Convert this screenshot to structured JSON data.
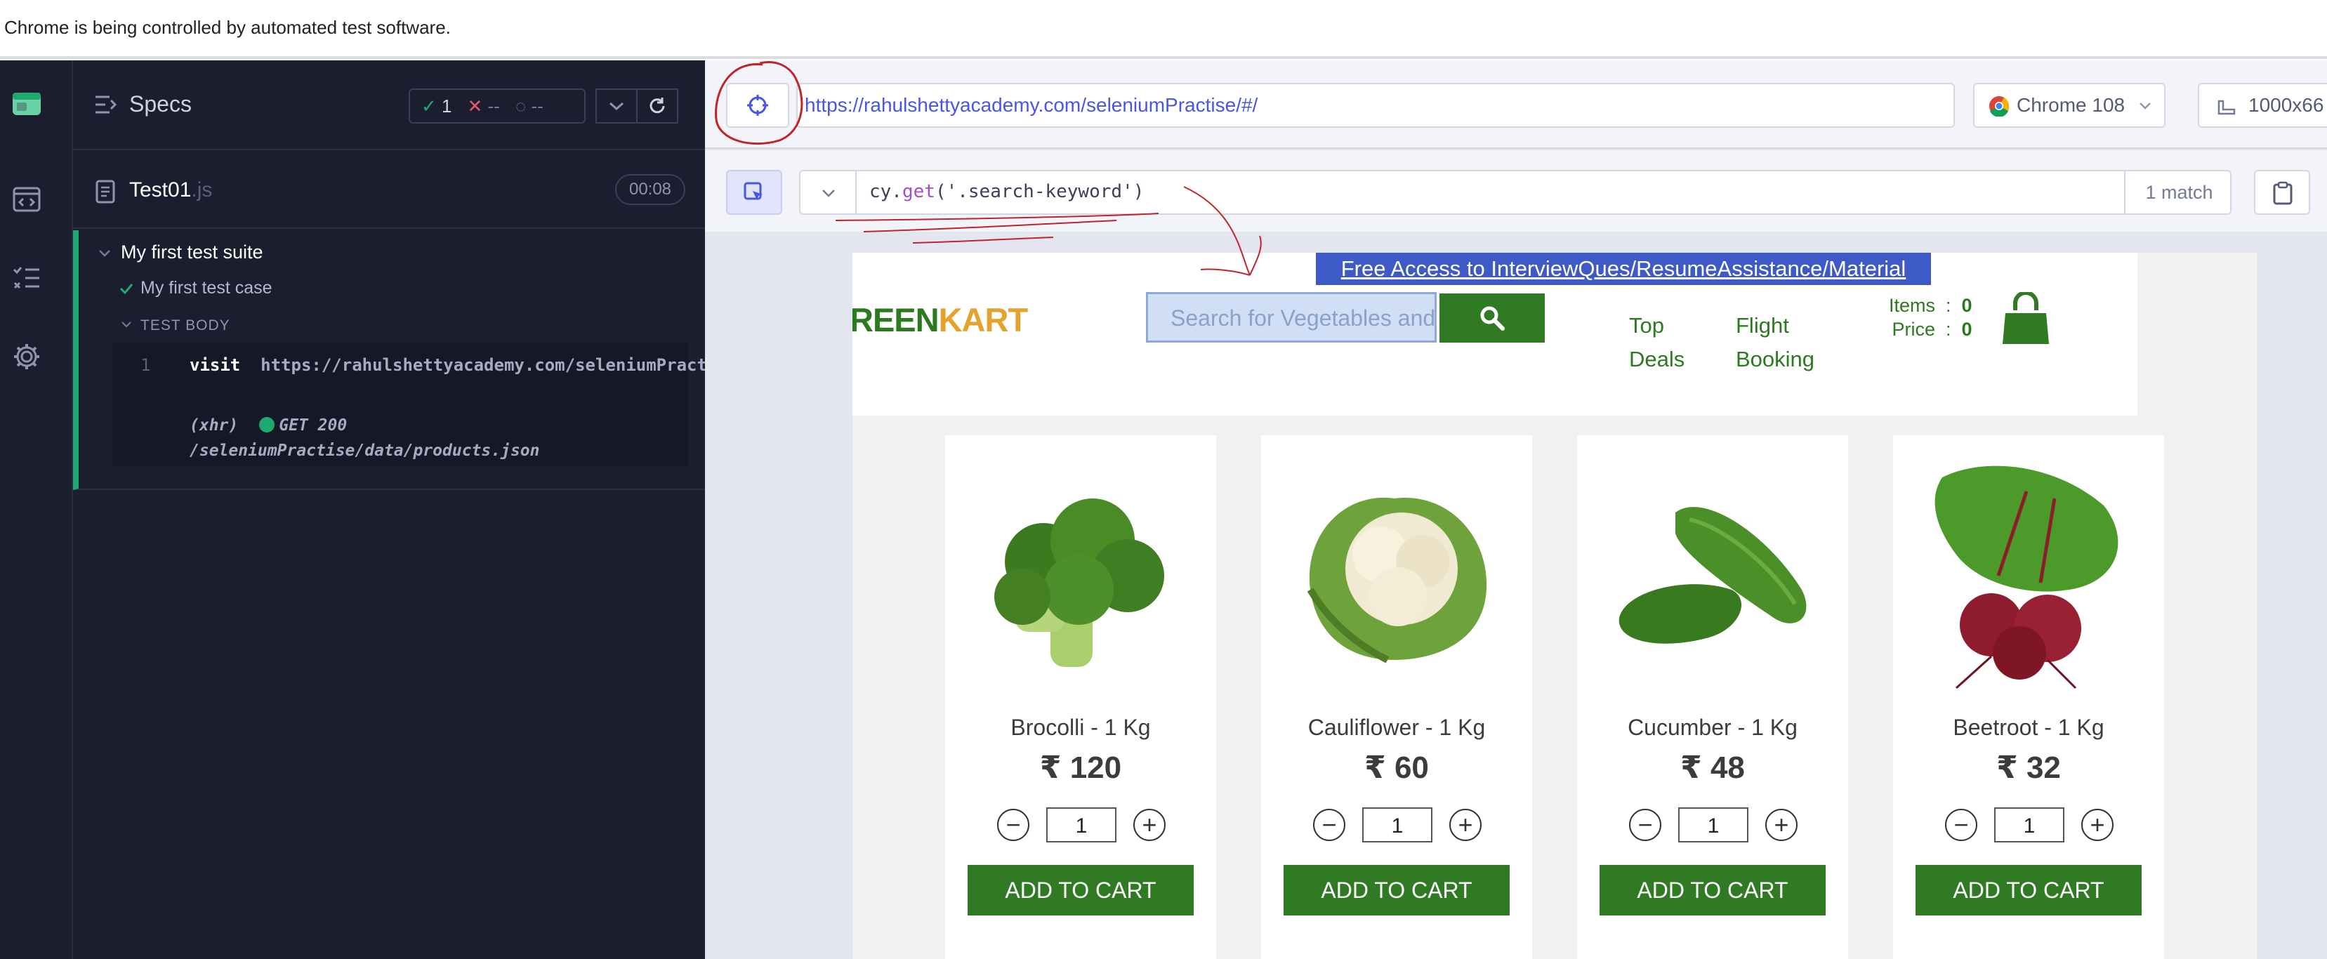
{
  "infobar": {
    "message": "Chrome is being controlled by automated test software."
  },
  "specs": {
    "title": "Specs",
    "stats": {
      "passed": "1",
      "failed": "--",
      "pending": "--"
    },
    "file": {
      "name": "Test01",
      "ext": ".js",
      "duration": "00:08"
    },
    "suite": "My first test suite",
    "test_case": "My first test case",
    "test_body_label": "TEST BODY",
    "commands": [
      {
        "line": "1",
        "name": "visit",
        "arg": "https://rahulshettyacademy.com/seleniumPractise/#/"
      },
      {
        "line": "",
        "name": "(xhr)",
        "arg": "GET 200 /seleniumPractise/data/products.json"
      }
    ]
  },
  "aut": {
    "url": "https://rahulshettyacademy.com/seleniumPractise/#/",
    "browser": "Chrome 108",
    "viewport": "1000x66",
    "selector": {
      "fn": "cy.",
      "method": "get",
      "arg": "('.search-keyword')",
      "matches": "1 match"
    }
  },
  "page": {
    "promo": "Free Access to InterviewQues/ResumeAssistance/Material",
    "logo_green": "REEN",
    "logo_orange": "KART",
    "search_placeholder": "Search for Vegetables and Fruits",
    "nav": [
      {
        "line1": "Top",
        "line2": "Deals"
      },
      {
        "line1": "Flight",
        "line2": "Booking"
      }
    ],
    "cart": {
      "items_label": "Items",
      "items_value": "0",
      "price_label": "Price",
      "price_value": "0"
    },
    "products": [
      {
        "name": "Brocolli - 1 Kg",
        "price": "₹ 120",
        "qty": "1",
        "button": "ADD TO CART",
        "image": "broccoli"
      },
      {
        "name": "Cauliflower - 1 Kg",
        "price": "₹ 60",
        "qty": "1",
        "button": "ADD TO CART",
        "image": "cauliflower"
      },
      {
        "name": "Cucumber - 1 Kg",
        "price": "₹ 48",
        "qty": "1",
        "button": "ADD TO CART",
        "image": "cucumber"
      },
      {
        "name": "Beetroot - 1 Kg",
        "price": "₹ 32",
        "qty": "1",
        "button": "ADD TO CART",
        "image": "beetroot"
      }
    ]
  },
  "colors": {
    "pass": "#1fa971",
    "fail": "#e45770",
    "brand_green": "#2f7a23",
    "brand_orange": "#e3a32d",
    "promo_blue": "#3d5ac7",
    "url_blue": "#4956e3"
  }
}
